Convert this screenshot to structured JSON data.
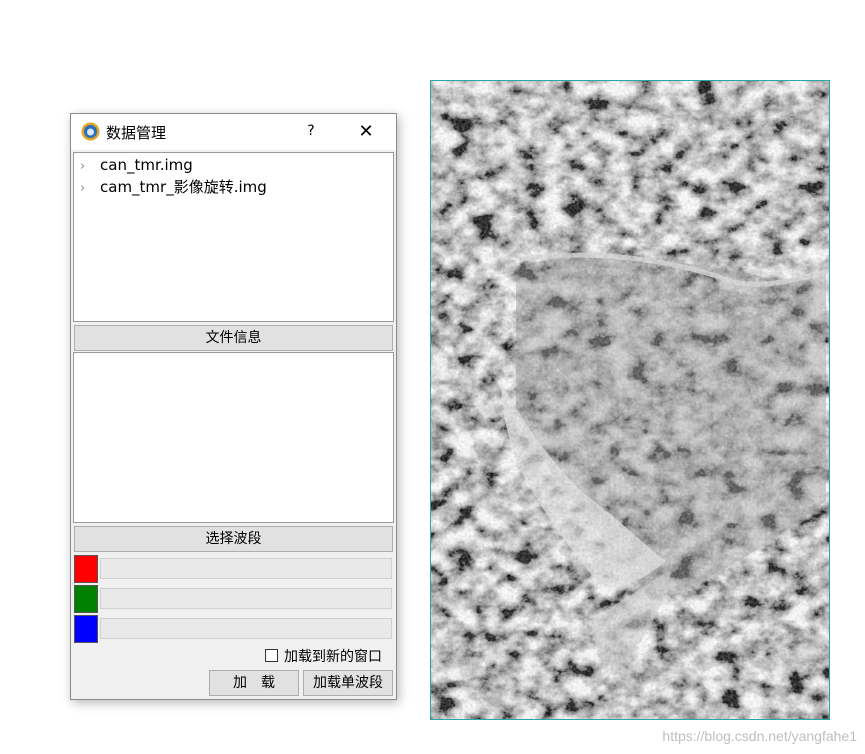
{
  "dialog": {
    "title": "数据管理",
    "help_label": "?",
    "close_label": "✕",
    "tree_items": [
      {
        "chevron": "›",
        "label": "can_tmr.img"
      },
      {
        "chevron": "›",
        "label": "cam_tmr_影像旋转.img"
      }
    ],
    "file_info_label": "文件信息",
    "select_band_label": "选择波段",
    "bands": [
      {
        "color": "#ff0000",
        "value": ""
      },
      {
        "color": "#008000",
        "value": ""
      },
      {
        "color": "#0000ff",
        "value": ""
      }
    ],
    "load_new_window_label": "加载到新的窗口",
    "load_label": "加　载",
    "load_single_band_label": "加载单波段"
  },
  "image": {
    "icon": "satellite-image",
    "border_color": "#2aa8a8"
  },
  "watermark": "https://blog.csdn.net/yangfahe1"
}
